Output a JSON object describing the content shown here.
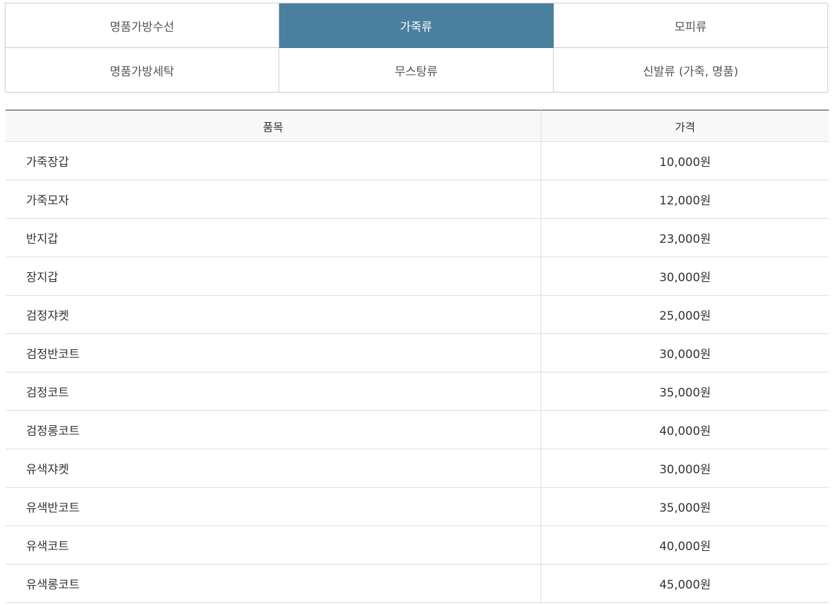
{
  "tabs": [
    {
      "label": "명품가방수선",
      "active": false
    },
    {
      "label": "가죽류",
      "active": true
    },
    {
      "label": "모피류",
      "active": false
    },
    {
      "label": "명품가방세탁",
      "active": false
    },
    {
      "label": "무스탕류",
      "active": false
    },
    {
      "label": "신발류 (가죽, 명품)",
      "active": false
    }
  ],
  "colors": {
    "active_tab": "#4a7f9e",
    "border": "#cccccc",
    "header_bg": "#f8f8f8"
  },
  "table": {
    "headers": {
      "item": "품목",
      "price": "가격"
    },
    "rows": [
      {
        "item": "가죽장갑",
        "price": "10,000원"
      },
      {
        "item": "가죽모자",
        "price": "12,000원"
      },
      {
        "item": "반지갑",
        "price": "23,000원"
      },
      {
        "item": "장지갑",
        "price": "30,000원"
      },
      {
        "item": "검정쟈켓",
        "price": "25,000원"
      },
      {
        "item": "검정반코트",
        "price": "30,000원"
      },
      {
        "item": "검정코트",
        "price": "35,000원"
      },
      {
        "item": "검정롱코트",
        "price": "40,000원"
      },
      {
        "item": "유색쟈켓",
        "price": "30,000원"
      },
      {
        "item": "유색반코트",
        "price": "35,000원"
      },
      {
        "item": "유색코트",
        "price": "40,000원"
      },
      {
        "item": "유색롱코트",
        "price": "45,000원"
      }
    ]
  }
}
